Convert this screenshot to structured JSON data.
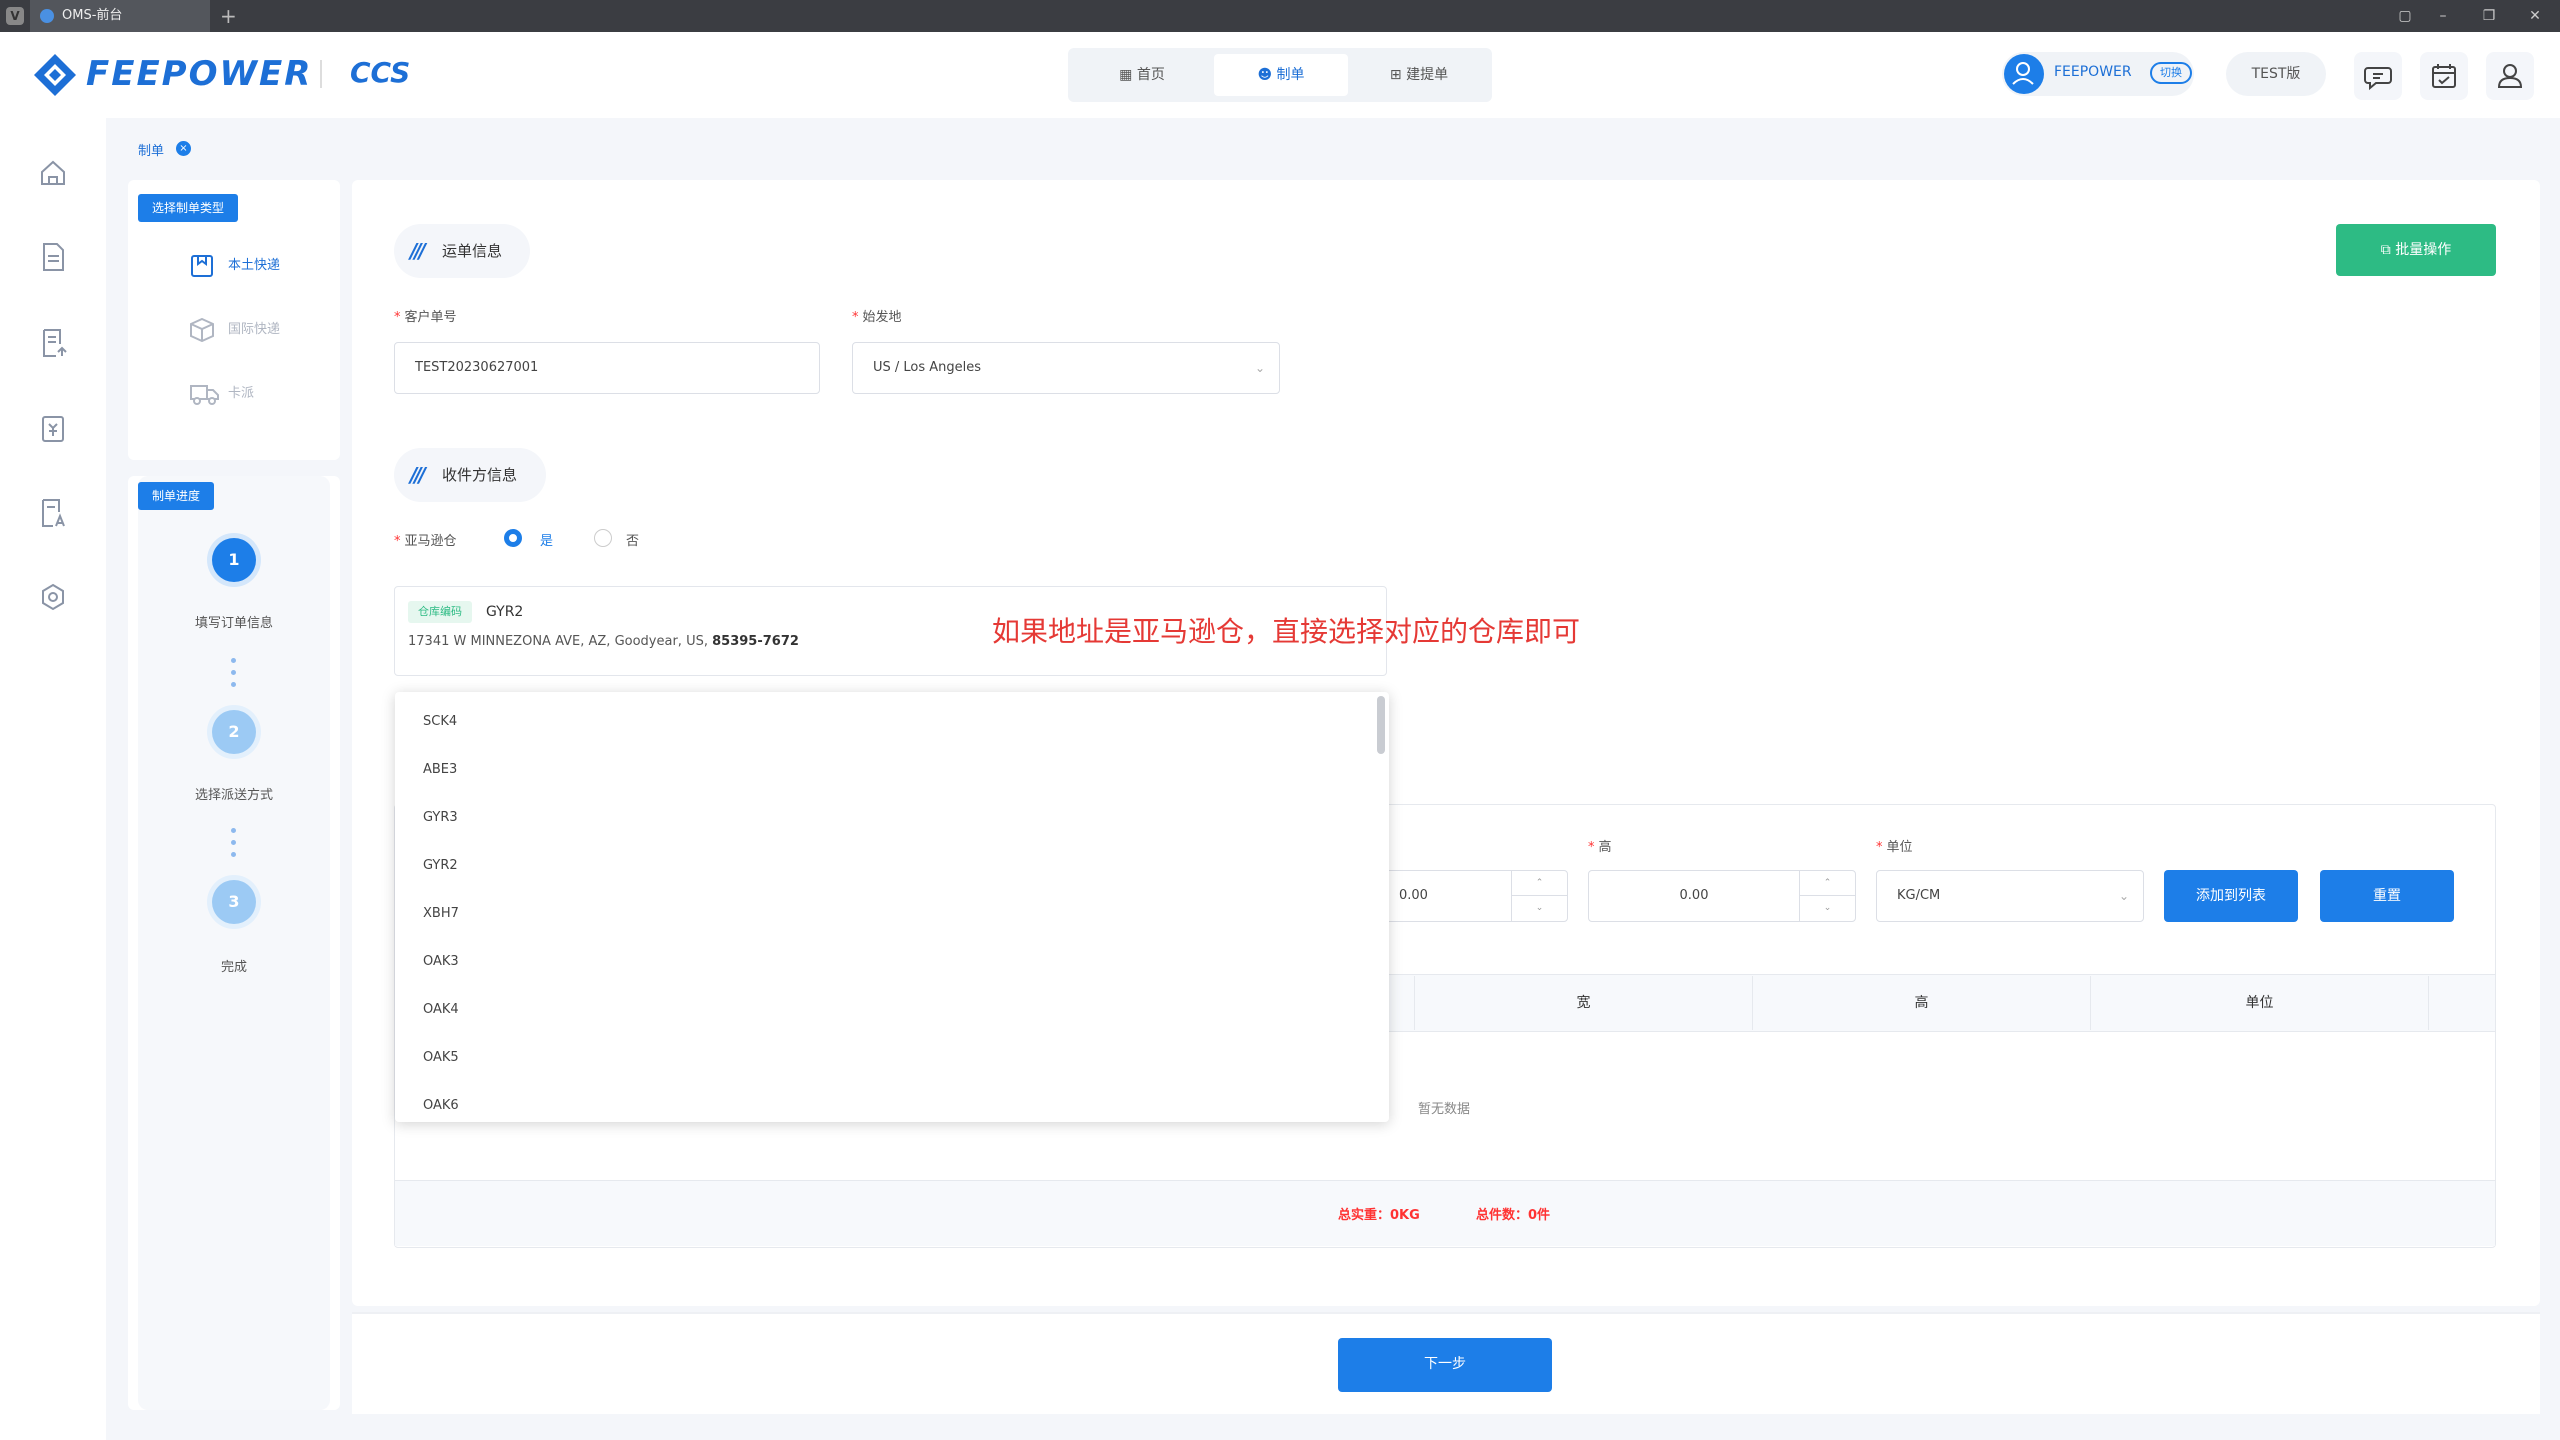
{
  "browser": {
    "tab_title": "OMS-前台",
    "new_tab_symbol": "+",
    "browser_badge": "V"
  },
  "header": {
    "logo_text": "FEEPOWER",
    "product": "CCS",
    "nav": [
      {
        "label": "首页"
      },
      {
        "label": "制单"
      },
      {
        "label": "建提单"
      }
    ],
    "user_name": "FEEPOWER",
    "switch_label": "切换",
    "version": "TEST版"
  },
  "breadcrumb": {
    "label": "制单",
    "close": "×"
  },
  "type_panel": {
    "tag": "选择制单类型",
    "items": [
      {
        "label": "本土快递"
      },
      {
        "label": "国际快递"
      },
      {
        "label": "卡派"
      }
    ]
  },
  "progress": {
    "tag": "制单进度",
    "steps": [
      {
        "num": "1",
        "label": "填写订单信息"
      },
      {
        "num": "2",
        "label": "选择派送方式"
      },
      {
        "num": "3",
        "label": "完成"
      }
    ]
  },
  "waybill": {
    "section_title": "运单信息",
    "batch_button": "批量操作",
    "customer_no_label": "客户单号",
    "customer_no_value": "TEST20230627001",
    "origin_label": "始发地",
    "origin_value": "US / Los Angeles"
  },
  "receiver": {
    "section_title": "收件方信息",
    "amazon_label": "亚马逊仓",
    "yes": "是",
    "no": "否",
    "addr_tag": "仓库编码",
    "addr_code": "GYR2",
    "addr_line": "17341 W MINNEZONA AVE, AZ, Goodyear, US, ",
    "addr_zip": "85395-7672"
  },
  "annotation": "如果地址是亚马逊仓，直接选择对应的仓库即可",
  "dropdown": {
    "options": [
      "SCK4",
      "ABE3",
      "GYR3",
      "GYR2",
      "XBH7",
      "OAK3",
      "OAK4",
      "OAK5",
      "OAK6"
    ]
  },
  "dims": {
    "width_value": "0.00",
    "height_label": "高",
    "height_value": "0.00",
    "unit_label": "单位",
    "unit_value": "KG/CM",
    "add_button": "添加到列表",
    "reset_button": "重置",
    "columns": [
      "宽",
      "高",
      "单位"
    ],
    "empty_text": "暂无数据",
    "total_weight": "总实重：0KG",
    "total_pieces": "总件数：0件"
  },
  "footer": {
    "next_button": "下一步"
  },
  "colors": {
    "primary": "#1d7ee8",
    "success": "#2dbb84",
    "danger": "#e53935"
  }
}
